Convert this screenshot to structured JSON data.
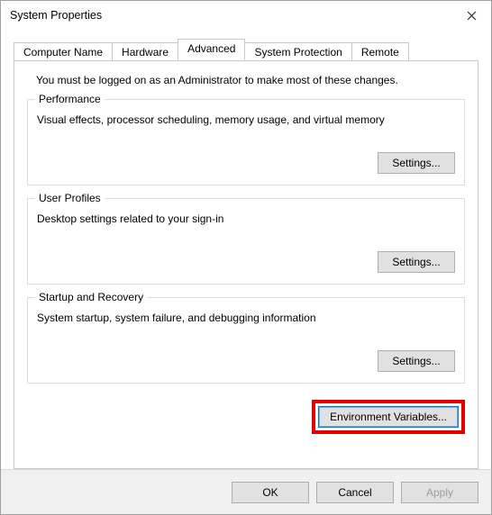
{
  "window": {
    "title": "System Properties"
  },
  "tabs": {
    "computerName": "Computer Name",
    "hardware": "Hardware",
    "advanced": "Advanced",
    "systemProtection": "System Protection",
    "remote": "Remote"
  },
  "intro": "You must be logged on as an Administrator to make most of these changes.",
  "groups": {
    "performance": {
      "legend": "Performance",
      "desc": "Visual effects, processor scheduling, memory usage, and virtual memory",
      "button": "Settings..."
    },
    "userProfiles": {
      "legend": "User Profiles",
      "desc": "Desktop settings related to your sign-in",
      "button": "Settings..."
    },
    "startup": {
      "legend": "Startup and Recovery",
      "desc": "System startup, system failure, and debugging information",
      "button": "Settings..."
    }
  },
  "envButton": "Environment Variables...",
  "bottom": {
    "ok": "OK",
    "cancel": "Cancel",
    "apply": "Apply"
  }
}
